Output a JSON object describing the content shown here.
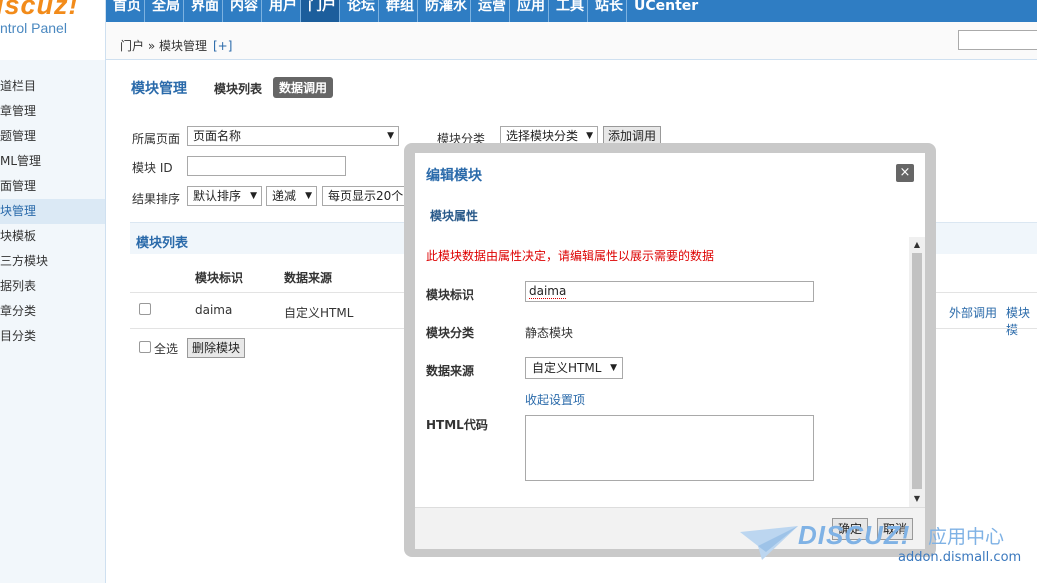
{
  "brand": {
    "logo": "iscuz!",
    "sub": "ntrol Panel"
  },
  "topnav": {
    "items": [
      {
        "label": "首页",
        "active": false
      },
      {
        "label": "全局",
        "active": false
      },
      {
        "label": "界面",
        "active": false
      },
      {
        "label": "内容",
        "active": false
      },
      {
        "label": "用户",
        "active": false
      },
      {
        "label": "门户",
        "active": true
      },
      {
        "label": "论坛",
        "active": false
      },
      {
        "label": "群组",
        "active": false
      },
      {
        "label": "防灌水",
        "active": false
      },
      {
        "label": "运营",
        "active": false
      },
      {
        "label": "应用",
        "active": false
      },
      {
        "label": "工具",
        "active": false
      },
      {
        "label": "站长",
        "active": false
      },
      {
        "label": "UCenter",
        "active": false
      }
    ]
  },
  "breadcrumb": {
    "path": "门户 » 模块管理",
    "plus": "[+]"
  },
  "sidebar": {
    "items": [
      {
        "label": "道栏目",
        "active": false
      },
      {
        "label": "章管理",
        "active": false
      },
      {
        "label": "题管理",
        "active": false
      },
      {
        "label": "ML管理",
        "active": false
      },
      {
        "label": "面管理",
        "active": false
      },
      {
        "label": "块管理",
        "active": true
      },
      {
        "label": "块模板",
        "active": false
      },
      {
        "label": "三方模块",
        "active": false
      },
      {
        "label": "据列表",
        "active": false
      },
      {
        "label": "章分类",
        "active": false
      },
      {
        "label": "目分类",
        "active": false
      }
    ]
  },
  "main": {
    "title": "模块管理",
    "tab_list": "模块列表",
    "tab_data": "数据调用",
    "filter": {
      "page_label": "所属页面",
      "page_select": "页面名称",
      "cat_label": "模块分类",
      "cat_select": "选择模块分类",
      "add_button": "添加调用",
      "id_label": "模块 ID",
      "sort_label": "结果排序",
      "sort_select": "默认排序",
      "order_select": "递减",
      "perpage_select": "每页显示20个"
    },
    "list": {
      "title": "模块列表",
      "col_id": "模块标识",
      "col_source": "数据来源",
      "rows": [
        {
          "id": "daima",
          "source": "自定义HTML",
          "link_external": "外部调用",
          "link_template": "模块模"
        }
      ],
      "select_all": "全选",
      "delete_button": "删除模块"
    }
  },
  "dialog": {
    "title": "编辑模块",
    "close": "×",
    "section": "模块属性",
    "note": "此模块数据由属性决定，请编辑属性以展示需要的数据",
    "fields": {
      "id_label": "模块标识",
      "id_value": "daima",
      "cat_label": "模块分类",
      "cat_value": "静态模块",
      "source_label": "数据来源",
      "source_value": "自定义HTML",
      "collapse_link": "收起设置项",
      "html_label": "HTML代码"
    },
    "ok": "确定",
    "cancel": "取消"
  },
  "watermark": {
    "logo": "DISCUZ!",
    "cn": "应用中心",
    "url": "addon.dismall.com"
  }
}
